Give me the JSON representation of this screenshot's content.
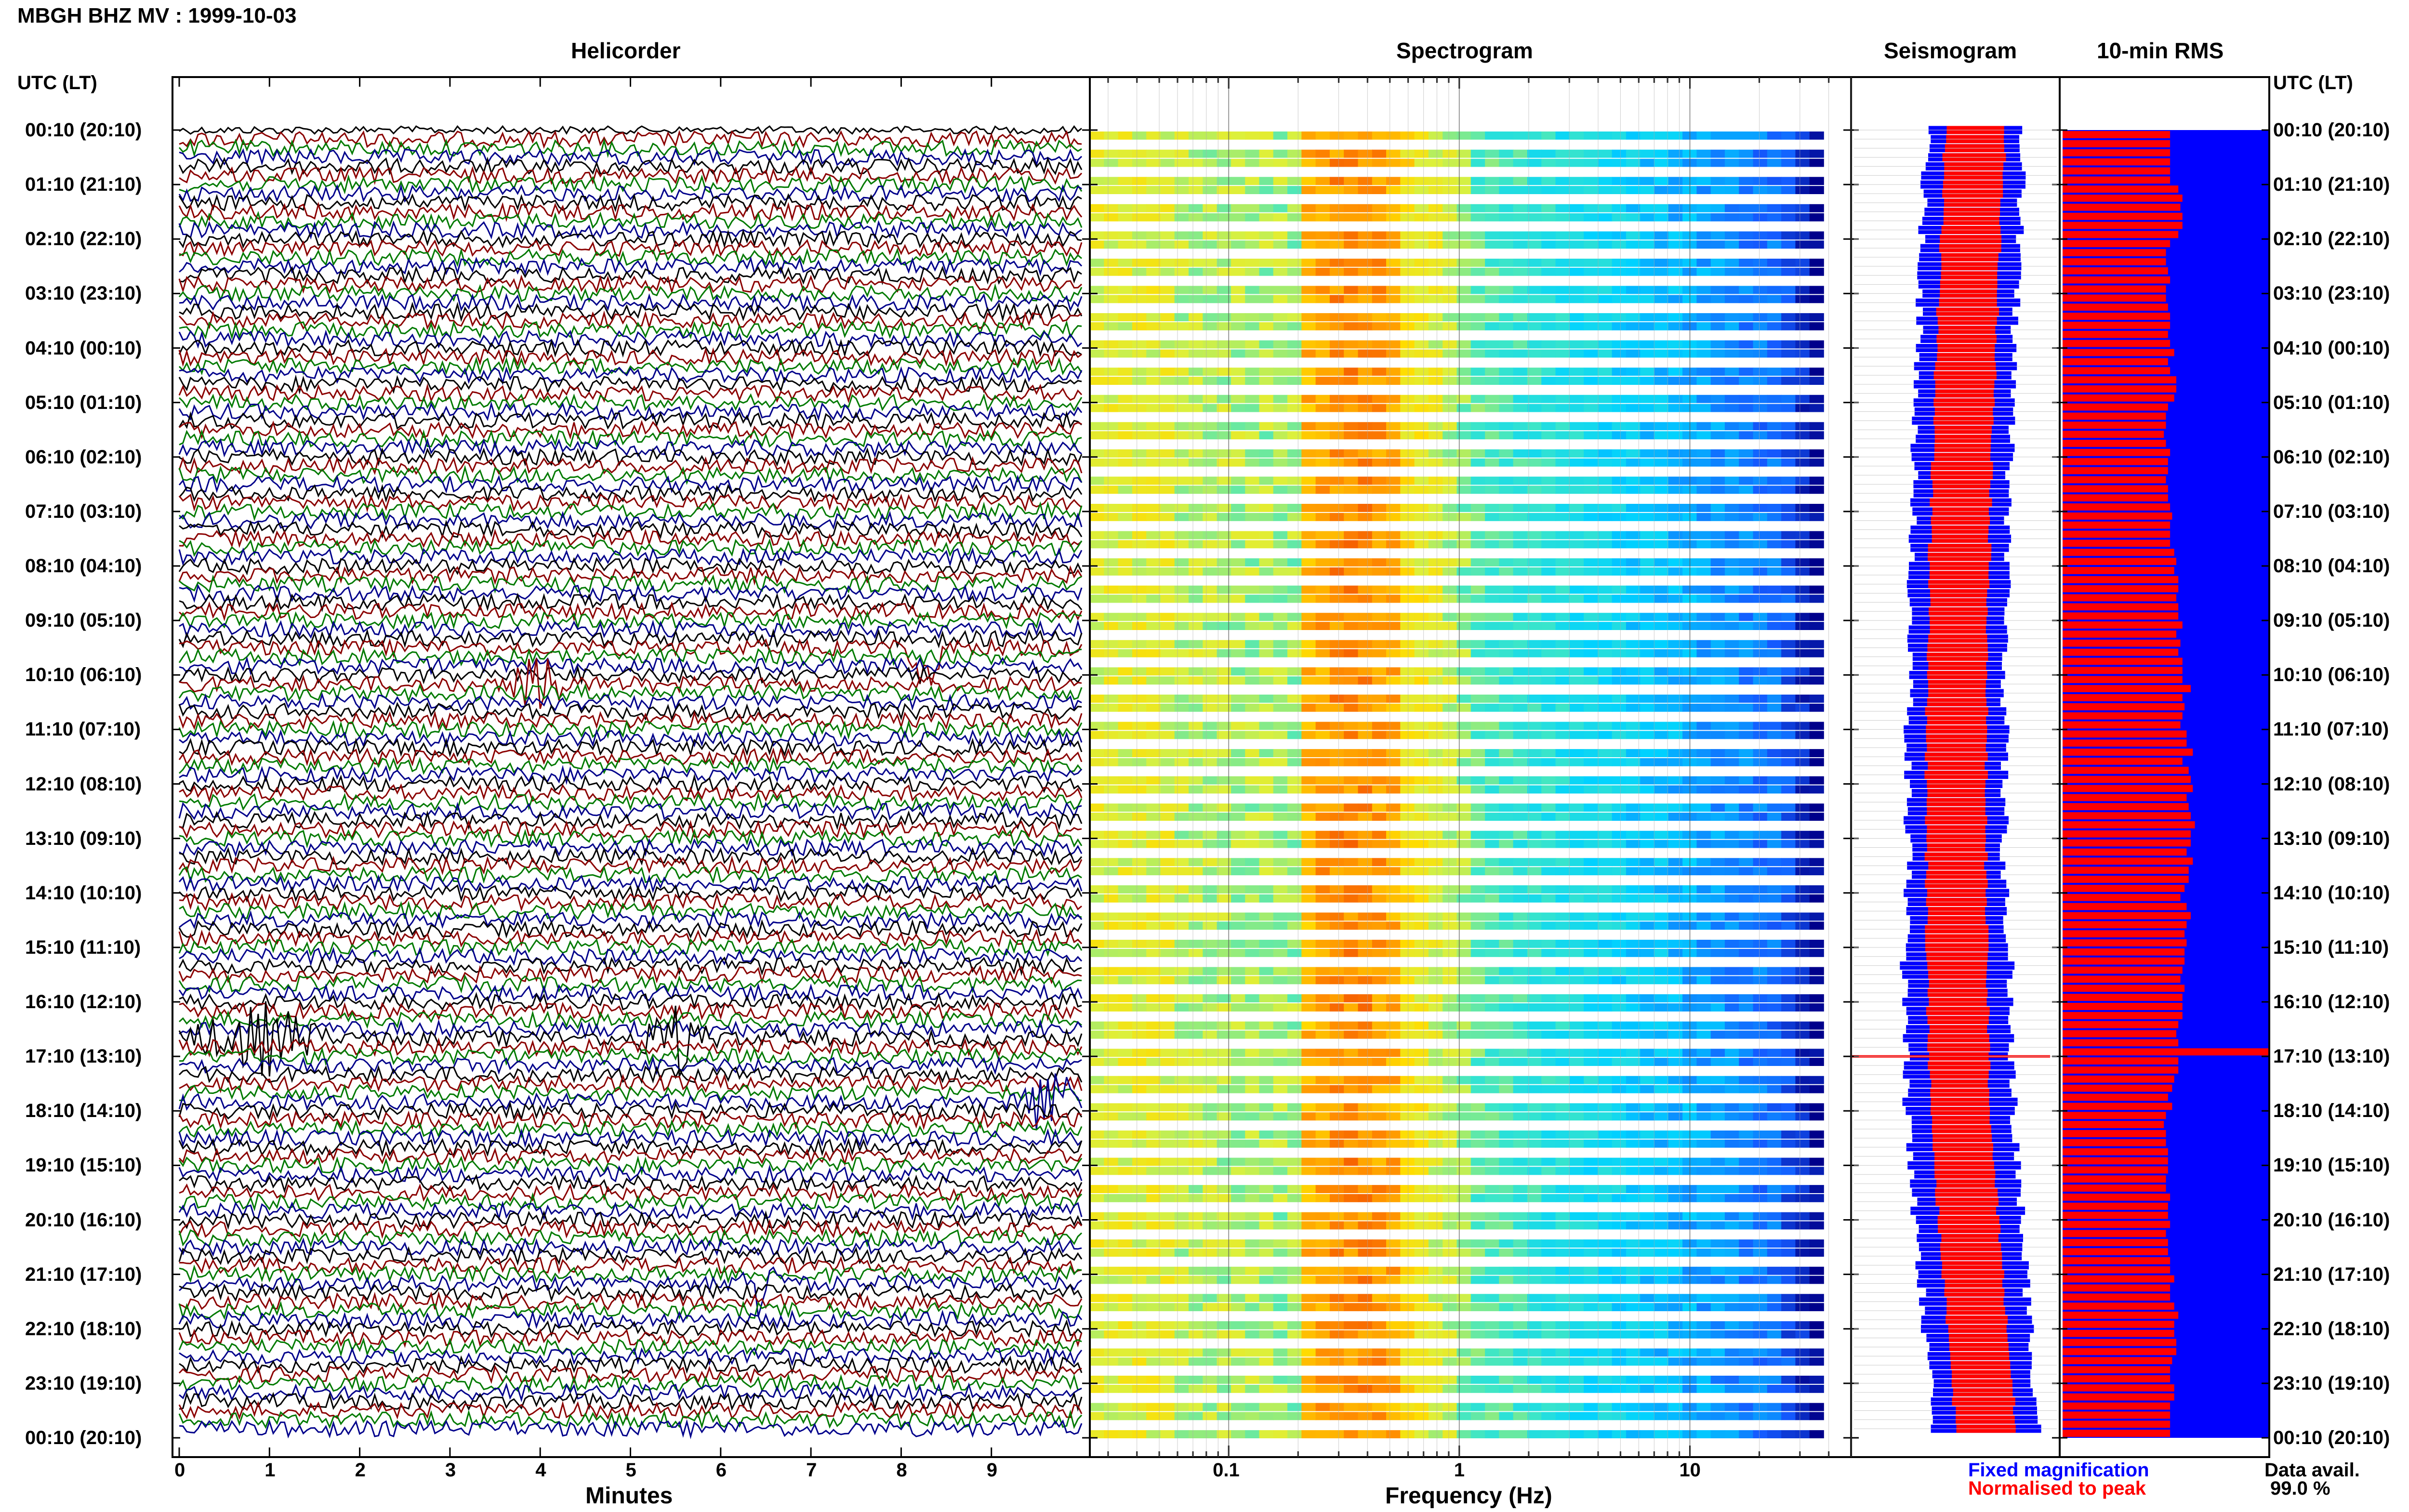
{
  "header": {
    "title": "MBGH BHZ MV : 1999-10-03"
  },
  "panels": {
    "helicorder_title": "Helicorder",
    "spectrogram_title": "Spectrogram",
    "seismogram_title": "Seismogram",
    "rms_title": "10-min RMS"
  },
  "axes": {
    "time_label_left": "UTC (LT)",
    "time_label_right": "UTC (LT)",
    "helicorder_xlabel": "Minutes",
    "spectrogram_xlabel": "Frequency (Hz)"
  },
  "legend": {
    "fixed_magnification": "Fixed magnification",
    "normalised_to_peak": "Normalised to peak",
    "fixed_color": "#0000ff",
    "normalised_color": "#ff0000"
  },
  "data_availability": {
    "label": "Data avail.",
    "value": "99.0 %"
  },
  "colors": {
    "helicorder_traces": [
      "#000000",
      "#8b0000",
      "#007a00",
      "#00008b"
    ],
    "spectrogram_low": "#00008b",
    "spectrogram_high": "#ff0000",
    "seismogram_fixed": "#0000ff",
    "seismogram_norm": "#ff0000",
    "rms_background": "#0000ff",
    "rms_bars": "#ff0000"
  },
  "chart_data": [
    {
      "type": "line",
      "name": "helicorder",
      "title": "Helicorder",
      "xlabel": "Minutes",
      "x_ticks": [
        0,
        1,
        2,
        3,
        4,
        5,
        6,
        7,
        8,
        9
      ],
      "xlim": [
        0,
        10
      ],
      "rows": 144,
      "row_minutes": 10,
      "time_ticks": [
        "00:10 (20:10)",
        "01:10 (21:10)",
        "02:10 (22:10)",
        "03:10 (23:10)",
        "04:10 (00:10)",
        "05:10 (01:10)",
        "06:10 (02:10)",
        "07:10 (03:10)",
        "08:10 (04:10)",
        "09:10 (05:10)",
        "10:10 (06:10)",
        "11:10 (07:10)",
        "12:10 (08:10)",
        "13:10 (09:10)",
        "14:10 (10:10)",
        "15:10 (11:10)",
        "16:10 (12:10)",
        "17:10 (13:10)",
        "18:10 (14:10)",
        "19:10 (15:10)",
        "20:10 (16:10)",
        "21:10 (17:10)",
        "22:10 (18:10)",
        "23:10 (19:10)",
        "00:10 (20:10)"
      ],
      "events": [
        {
          "utc": "09:40",
          "minute_start": 8.0,
          "minute_end": 8.6,
          "color": "#007a00"
        },
        {
          "utc": "10:20",
          "minute_start": 3.6,
          "minute_end": 4.3,
          "color": "#8b0000"
        },
        {
          "utc": "16:50",
          "minute_start": 0.0,
          "minute_end": 1.7,
          "color": "#007a00"
        },
        {
          "utc": "16:50",
          "minute_start": 5.0,
          "minute_end": 6.0,
          "color": "#007a00"
        },
        {
          "utc": "18:00",
          "minute_start": 9.3,
          "minute_end": 10.0,
          "color": "#8b0000"
        },
        {
          "utc": "21:20",
          "minute_start": 6.2,
          "minute_end": 6.7,
          "color": "#000000"
        }
      ]
    },
    {
      "type": "heatmap",
      "name": "spectrogram",
      "title": "Spectrogram",
      "xlabel": "Frequency (Hz)",
      "x_scale": "log",
      "xlim": [
        0.025,
        50
      ],
      "x_ticks": [
        "0.1",
        "1",
        "10"
      ],
      "peak_band_hz": [
        0.25,
        0.5
      ]
    },
    {
      "type": "line",
      "name": "seismogram",
      "title": "Seismogram",
      "series": [
        {
          "name": "Fixed magnification",
          "color": "#0000ff"
        },
        {
          "name": "Normalised to peak",
          "color": "#ff0000"
        }
      ]
    },
    {
      "type": "bar",
      "name": "rms",
      "title": "10-min RMS",
      "notable_peak_utc": "17:10",
      "relative_values": [
        0.52,
        0.52,
        0.52,
        0.52,
        0.52,
        0.52,
        0.56,
        0.58,
        0.57,
        0.58,
        0.58,
        0.56,
        0.52,
        0.5,
        0.5,
        0.51,
        0.52,
        0.5,
        0.5,
        0.51,
        0.52,
        0.52,
        0.51,
        0.52,
        0.54,
        0.51,
        0.52,
        0.55,
        0.55,
        0.54,
        0.51,
        0.5,
        0.5,
        0.49,
        0.5,
        0.52,
        0.51,
        0.51,
        0.5,
        0.51,
        0.51,
        0.52,
        0.53,
        0.52,
        0.52,
        0.52,
        0.54,
        0.55,
        0.54,
        0.56,
        0.56,
        0.55,
        0.56,
        0.56,
        0.58,
        0.55,
        0.57,
        0.56,
        0.58,
        0.58,
        0.58,
        0.62,
        0.58,
        0.59,
        0.58,
        0.57,
        0.6,
        0.6,
        0.63,
        0.58,
        0.61,
        0.62,
        0.63,
        0.6,
        0.61,
        0.62,
        0.64,
        0.62,
        0.62,
        0.6,
        0.63,
        0.61,
        0.61,
        0.59,
        0.57,
        0.6,
        0.62,
        0.6,
        0.59,
        0.6,
        0.59,
        0.59,
        0.58,
        0.57,
        0.59,
        0.58,
        0.58,
        0.58,
        0.56,
        0.55,
        0.56,
        1.0,
        0.56,
        0.56,
        0.54,
        0.53,
        0.51,
        0.53,
        0.5,
        0.49,
        0.5,
        0.5,
        0.51,
        0.51,
        0.51,
        0.5,
        0.5,
        0.52,
        0.51,
        0.51,
        0.52,
        0.5,
        0.51,
        0.51,
        0.52,
        0.52,
        0.54,
        0.52,
        0.52,
        0.54,
        0.56,
        0.54,
        0.54,
        0.55,
        0.55,
        0.53,
        0.52,
        0.52,
        0.54,
        0.54,
        0.52,
        0.52,
        0.52,
        0.52
      ]
    }
  ]
}
